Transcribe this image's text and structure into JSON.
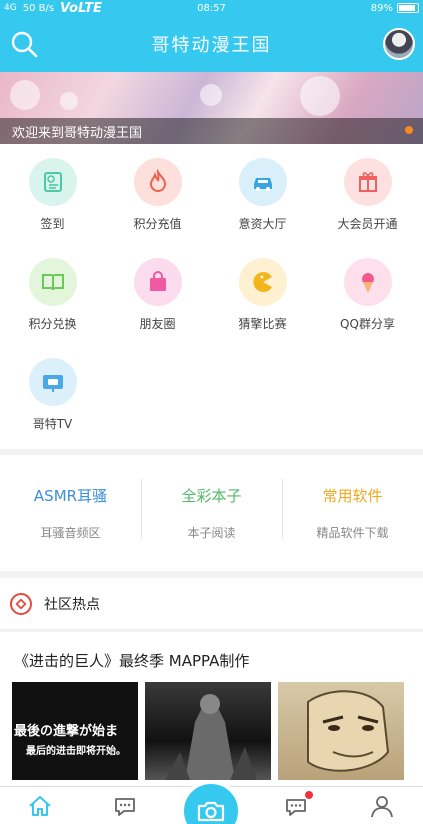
{
  "status_bar": {
    "signal": "4G",
    "speed": "50 B/s",
    "volte": "VoLTE",
    "time": "08:57",
    "battery": "89%"
  },
  "header": {
    "title": "哥特动漫王国"
  },
  "banner": {
    "caption": "欢迎来到哥特动漫王国"
  },
  "grid": [
    {
      "label": "签到",
      "icon": "checkin-icon",
      "color": "#4cc9a6",
      "bg": "#d8f4ec"
    },
    {
      "label": "积分充值",
      "icon": "flame-icon",
      "color": "#f0604d",
      "bg": "#fde0dc"
    },
    {
      "label": "意资大厅",
      "icon": "car-icon",
      "color": "#3aa5e0",
      "bg": "#d9effa"
    },
    {
      "label": "大会员开通",
      "icon": "gift-icon",
      "color": "#f06060",
      "bg": "#fde0e0"
    },
    {
      "label": "积分兑换",
      "icon": "book-icon",
      "color": "#6cc85a",
      "bg": "#e3f6dc"
    },
    {
      "label": "朋友圈",
      "icon": "bag-icon",
      "color": "#ef5aa0",
      "bg": "#fbdcef"
    },
    {
      "label": "猜擎比赛",
      "icon": "pacman-icon",
      "color": "#f2b51c",
      "bg": "#fdf1d1"
    },
    {
      "label": "QQ群分享",
      "icon": "icecream-icon",
      "color": "#f25a8f",
      "bg": "#fde0ec"
    },
    {
      "label": "哥特TV",
      "icon": "tv-icon",
      "color": "#4aa9e5",
      "bg": "#dcf0fb"
    }
  ],
  "features": [
    {
      "title": "ASMR耳骚",
      "subtitle": "耳骚音频区",
      "color": "#3c8fd8"
    },
    {
      "title": "全彩本子",
      "subtitle": "本子阅读",
      "color": "#52b868"
    },
    {
      "title": "常用软件",
      "subtitle": "精品软件下载",
      "color": "#f0a822"
    }
  ],
  "community": {
    "title": "社区热点"
  },
  "post": {
    "title": "《进击的巨人》最终季 MAPPA制作",
    "thumbs": [
      {
        "caption_top": "最後の進撃が始ま",
        "caption_bottom": "最后的进击即将开始。"
      },
      {
        "caption_top": "",
        "caption_bottom": ""
      },
      {
        "caption_top": "",
        "caption_bottom": ""
      }
    ]
  },
  "colors": {
    "accent": "#35c9f0"
  }
}
